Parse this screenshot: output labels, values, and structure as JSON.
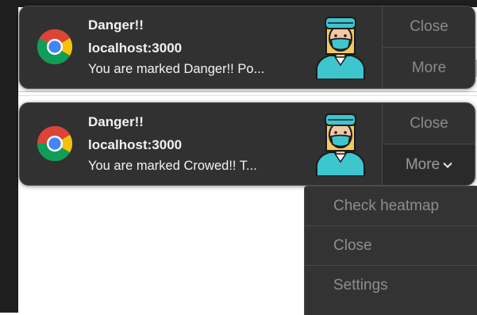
{
  "notifications": [
    {
      "title": "Danger!!",
      "site": "localhost:3000",
      "message": "You are marked Danger!! Po...",
      "close_label": "Close",
      "more_label": "More"
    },
    {
      "title": "Danger!!",
      "site": "localhost:3000",
      "message": "You are marked Crowed!! T...",
      "close_label": "Close",
      "more_label": "More"
    }
  ],
  "more_menu": {
    "items": [
      "Check heatmap",
      "Close",
      "Settings"
    ]
  },
  "icons": {
    "app_icon": "chrome-icon",
    "notification_image": "masked-doctor-icon",
    "dropdown": "chevron-down-icon"
  },
  "colors": {
    "notification_bg": "#313131",
    "menu_bg": "#333333",
    "accent_teal": "#3ec6cf"
  }
}
